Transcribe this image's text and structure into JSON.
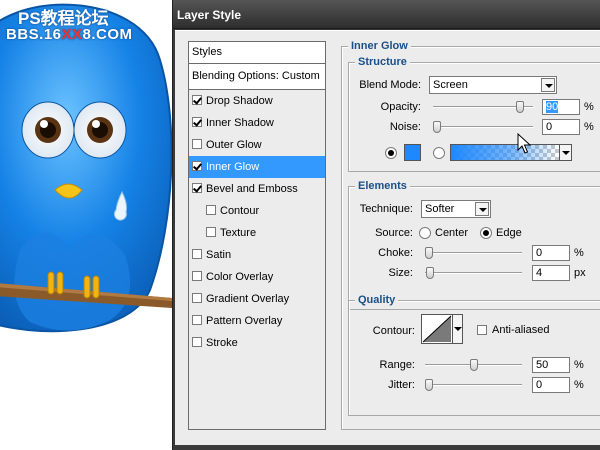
{
  "watermark": {
    "line1": "PS教程论坛",
    "line2_a": "BBS.16",
    "line2_b": "XX",
    "line2_c": "8.COM"
  },
  "dialog": {
    "title": "Layer Style"
  },
  "style_list": {
    "header": "Styles",
    "blending": "Blending Options: Custom",
    "items": [
      {
        "label": "Drop Shadow",
        "checked": true,
        "sub": false,
        "active": false
      },
      {
        "label": "Inner Shadow",
        "checked": true,
        "sub": false,
        "active": false
      },
      {
        "label": "Outer Glow",
        "checked": false,
        "sub": false,
        "active": false
      },
      {
        "label": "Inner Glow",
        "checked": true,
        "sub": false,
        "active": true
      },
      {
        "label": "Bevel and Emboss",
        "checked": true,
        "sub": false,
        "active": false
      },
      {
        "label": "Contour",
        "checked": false,
        "sub": true,
        "active": false
      },
      {
        "label": "Texture",
        "checked": false,
        "sub": true,
        "active": false
      },
      {
        "label": "Satin",
        "checked": false,
        "sub": false,
        "active": false
      },
      {
        "label": "Color Overlay",
        "checked": false,
        "sub": false,
        "active": false
      },
      {
        "label": "Gradient Overlay",
        "checked": false,
        "sub": false,
        "active": false
      },
      {
        "label": "Pattern Overlay",
        "checked": false,
        "sub": false,
        "active": false
      },
      {
        "label": "Stroke",
        "checked": false,
        "sub": false,
        "active": false
      }
    ]
  },
  "inner_glow": {
    "title": "Inner Glow",
    "structure": {
      "title": "Structure",
      "blend_mode_label": "Blend Mode:",
      "blend_mode_value": "Screen",
      "opacity_label": "Opacity:",
      "opacity_value": "90",
      "opacity_unit": "%",
      "noise_label": "Noise:",
      "noise_value": "0",
      "noise_unit": "%",
      "glow_color": "#1e88ff"
    },
    "elements": {
      "title": "Elements",
      "technique_label": "Technique:",
      "technique_value": "Softer",
      "source_label": "Source:",
      "source_center": "Center",
      "source_edge": "Edge",
      "choke_label": "Choke:",
      "choke_value": "0",
      "choke_unit": "%",
      "size_label": "Size:",
      "size_value": "4",
      "size_unit": "px"
    },
    "quality": {
      "title": "Quality",
      "contour_label": "Contour:",
      "anti_aliased_label": "Anti-aliased",
      "range_label": "Range:",
      "range_value": "50",
      "range_unit": "%",
      "jitter_label": "Jitter:",
      "jitter_value": "0",
      "jitter_unit": "%"
    }
  },
  "colors": {
    "accent_selected": "#3399ff",
    "group_label": "#19508a",
    "bird_blue": "#1e88ff"
  }
}
